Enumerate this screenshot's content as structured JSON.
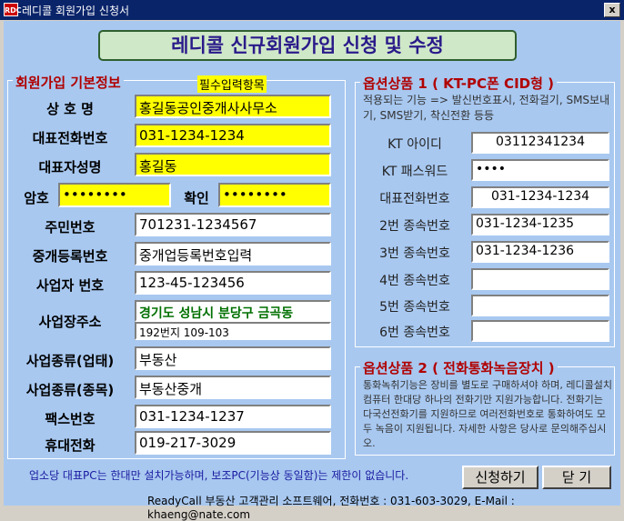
{
  "window": {
    "icon_text": "RDC",
    "title": "레디콜 회원가입 신청서",
    "close_label": "x"
  },
  "banner": "레디콜 신규회원가입 신청 및 수정",
  "basic": {
    "legend": "회원가입 기본정보",
    "required_tag": "필수입력항목",
    "company_label": "상 호 명",
    "company_value": "홍길동공인중개사사무소",
    "phone_label": "대표전화번호",
    "phone_value": "031-1234-1234",
    "rep_label": "대표자성명",
    "rep_value": "홍길동",
    "pw_label": "암호",
    "pw_value": "••••••••",
    "confirm_label": "확인",
    "confirm_value": "••••••••",
    "rrn_label": "주민번호",
    "rrn_value": "701231-1234567",
    "reg_label": "중개등록번호",
    "reg_value": "중개업등록번호입력",
    "biz_label": "사업자 번호",
    "biz_value": "123-45-123456",
    "addr_label": "사업장주소",
    "addr_value1": "경기도 성남시 분당구 금곡동",
    "addr_value2": "192번지 109-103",
    "type1_label": "사업종류(업태)",
    "type1_value": "부동산",
    "type2_label": "사업종류(종목)",
    "type2_value": "부동산중개",
    "fax_label": "팩스번호",
    "fax_value": "031-1234-1237",
    "mobile_label": "휴대전화",
    "mobile_value": "019-217-3029"
  },
  "option1": {
    "legend": "옵션상품 1 ( KT-PC폰 CID형 )",
    "desc": "적용되는 기능 => 발신번호표시, 전화걸기, SMS보내기, SMS받기, 착신전환 등등",
    "kt_id_label": "KT 아이디",
    "kt_id_value": "03112341234",
    "kt_pw_label": "KT 패스워드",
    "kt_pw_value": "••••",
    "main_label": "대표전화번호",
    "main_value": "031-1234-1234",
    "sub2_label": "2번 종속번호",
    "sub2_value": "031-1234-1235",
    "sub3_label": "3번 종속번호",
    "sub3_value": "031-1234-1236",
    "sub4_label": "4번 종속번호",
    "sub4_value": "",
    "sub5_label": "5번 종속번호",
    "sub5_value": "",
    "sub6_label": "6번 종속번호",
    "sub6_value": ""
  },
  "option2": {
    "legend": "옵션상품 2 ( 전화통화녹음장치 )",
    "desc": "통화녹취기능은 장비를 별도로 구매하셔야 하며, 레디콜설치컴퓨터 한대당 하나의 전화기만 지원가능합니다. 전화기는 다국선전화기를 지원하므로 여러전화번호로 통화하여도 모두 녹음이 지원됩니다. 자세한 사항은 당사로 문의해주십시오."
  },
  "notice": "업소당 대표PC는 한대만 설치가능하며, 보조PC(기능상 동일함)는 제한이 없습니다.",
  "buttons": {
    "submit": "신청하기",
    "close": "닫 기"
  },
  "footer": "ReadyCall 부동산 고객관리 소프트웨어,     전화번호 : 031-603-3029, E-Mail : khaeng@nate.com"
}
